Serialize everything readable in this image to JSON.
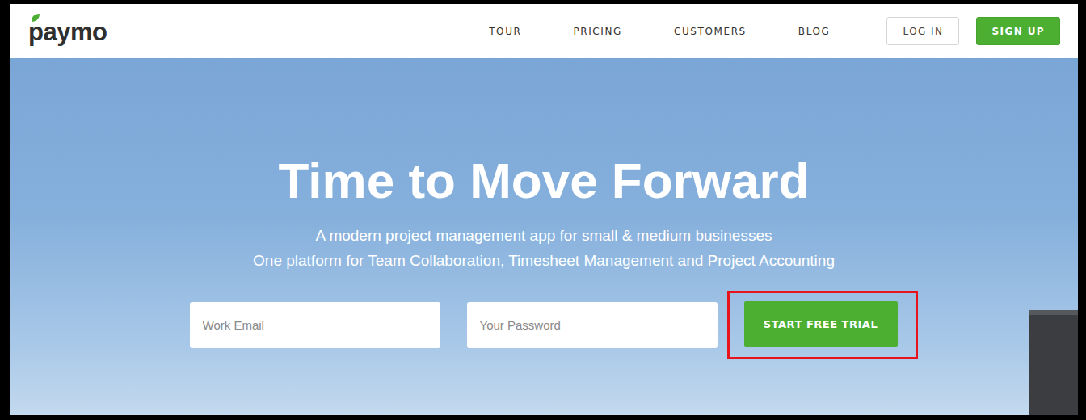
{
  "logo": {
    "text": "paymo"
  },
  "nav": [
    {
      "label": "TOUR"
    },
    {
      "label": "PRICING"
    },
    {
      "label": "CUSTOMERS"
    },
    {
      "label": "BLOG"
    }
  ],
  "header_buttons": [
    {
      "label": "LOG IN",
      "kind": "outline"
    },
    {
      "label": "SIGN UP",
      "kind": "filled"
    }
  ],
  "hero": {
    "title": "Time to Move Forward",
    "subtitles": [
      "A modern project management app for small & medium businesses",
      "One platform for Team Collaboration, Timesheet Management and Project Accounting"
    ]
  },
  "form": {
    "fields": [
      {
        "placeholder": "Work Email"
      },
      {
        "placeholder": "Your Password"
      }
    ],
    "submit": {
      "label": "START FREE TRIAL",
      "highlighted": true
    }
  }
}
